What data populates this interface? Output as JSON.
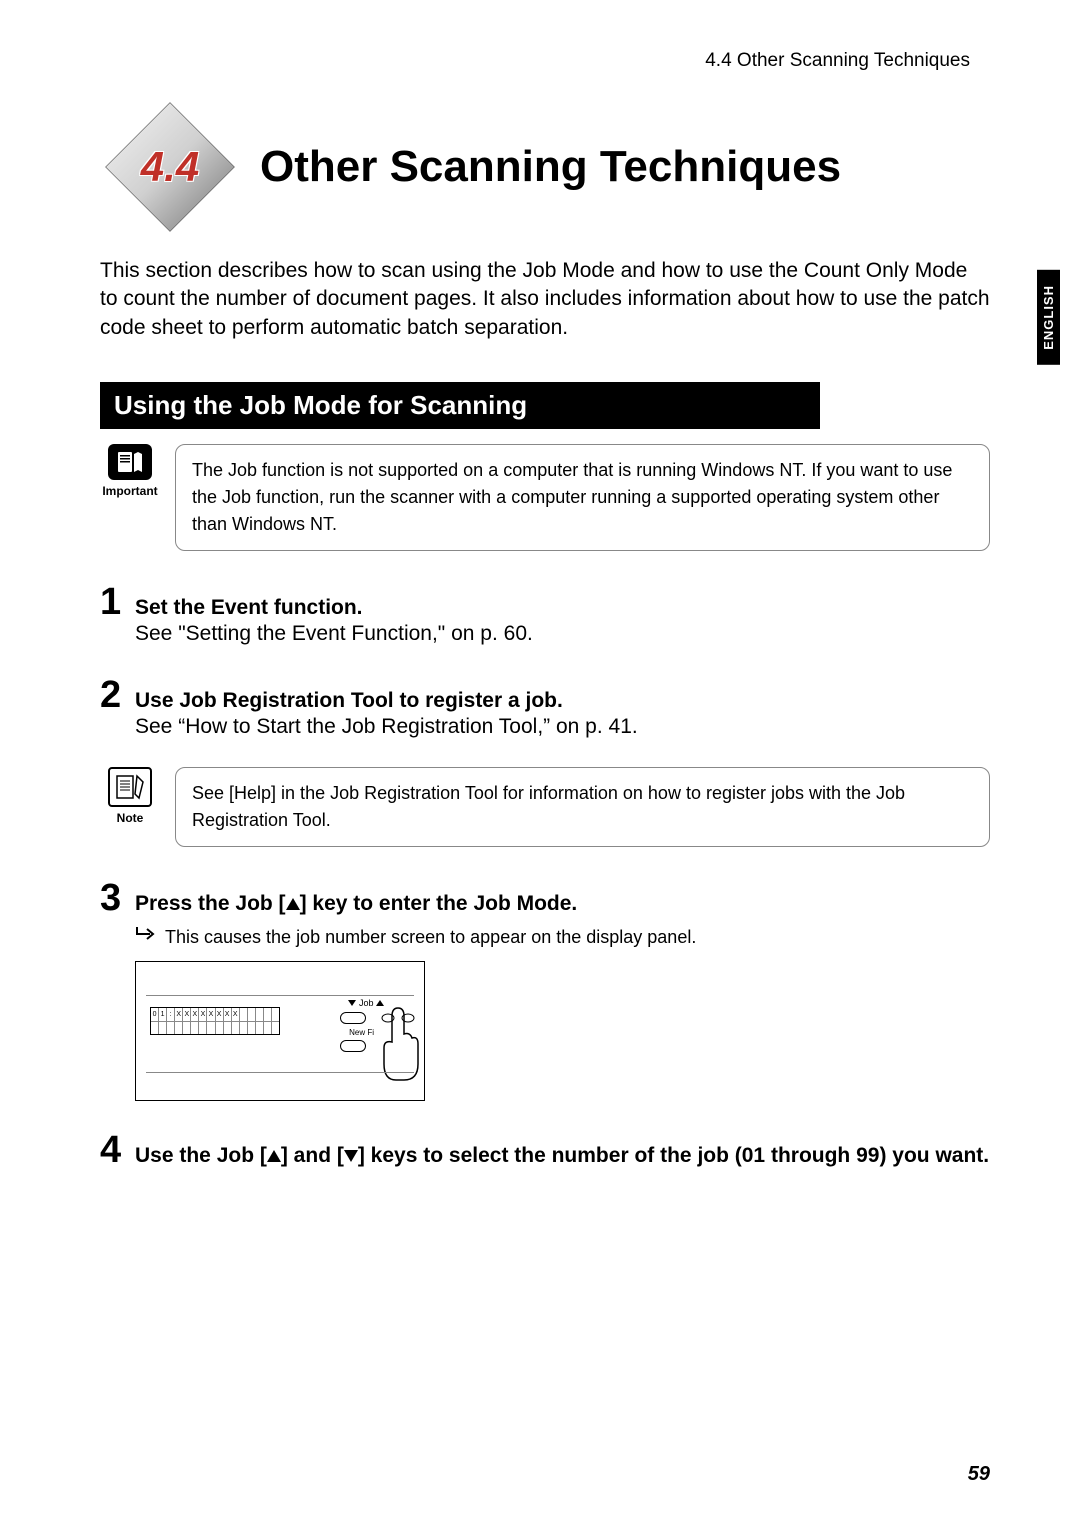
{
  "header": {
    "breadcrumb": "4.4   Other Scanning Techniques"
  },
  "section_number": "4.4",
  "title": "Other Scanning Techniques",
  "intro": "This section describes how to scan using the Job Mode and how to use the Count Only Mode to count the number of document pages. It also includes information about how to use the patch code sheet to perform automatic batch separation.",
  "language_tab": "ENGLISH",
  "subsection": "Using the Job Mode for Scanning",
  "important": {
    "label": "Important",
    "text": "The Job function is not supported on a computer that is running Windows NT. If you want to use the Job function, run the scanner with a computer running a supported operating system other than Windows NT."
  },
  "steps": {
    "s1": {
      "num": "1",
      "title": "Set the Event function.",
      "desc": "See \"Setting the Event Function,\" on p. 60."
    },
    "s2": {
      "num": "2",
      "title": "Use Job Registration Tool to register a job.",
      "desc": "See “How to Start the Job Registration Tool,” on p. 41."
    },
    "s3": {
      "num": "3",
      "title_before": "Press the Job [",
      "title_after": "] key to enter the Job Mode.",
      "sub": "This causes the job number screen to appear on the display panel."
    },
    "s4": {
      "num": "4",
      "title_before": "Use the Job [",
      "title_mid": "] and [",
      "title_after": "] keys to select the number of the job (01 through 99) you want."
    }
  },
  "note": {
    "label": "Note",
    "text": "See [Help] in the Job Registration Tool for information on how to register jobs with the Job Registration Tool."
  },
  "panel": {
    "lcd_top": "01:XXXXXXXX",
    "job": "Job",
    "newfile": "New Fi"
  },
  "page_number": "59"
}
